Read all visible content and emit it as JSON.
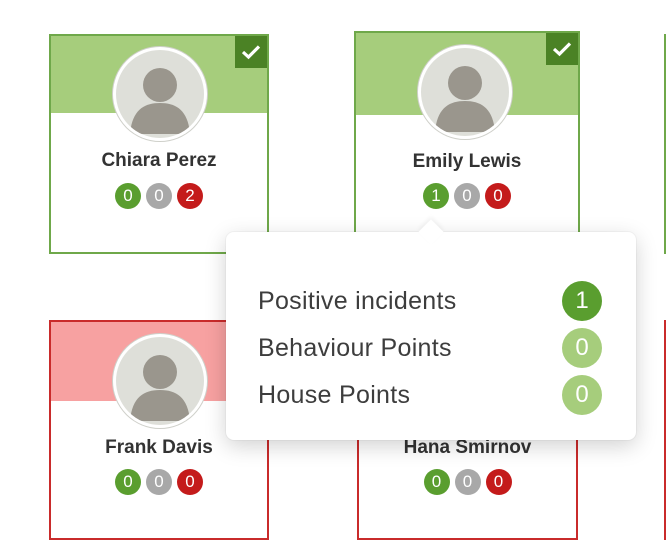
{
  "students": [
    {
      "name": "Chiara Perez",
      "status": "present",
      "selected": true,
      "counts": {
        "positive": "0",
        "neutral": "0",
        "negative": "2"
      }
    },
    {
      "name": "Emily Lewis",
      "status": "present",
      "selected": true,
      "counts": {
        "positive": "1",
        "neutral": "0",
        "negative": "0"
      }
    },
    {
      "name": "Frank Davis",
      "status": "absent",
      "selected": false,
      "counts": {
        "positive": "0",
        "neutral": "0",
        "negative": "0"
      }
    },
    {
      "name": "Hana Smirnov",
      "status": "absent",
      "selected": false,
      "counts": {
        "positive": "0",
        "neutral": "0",
        "negative": "0"
      }
    }
  ],
  "popover": {
    "rows": [
      {
        "label": "Positive incidents",
        "value": "1"
      },
      {
        "label": "Behaviour Points",
        "value": "0"
      },
      {
        "label": "House Points",
        "value": "0"
      }
    ]
  },
  "colors": {
    "present_border": "#6fa84a",
    "present_banner": "#a6cd7c",
    "absent_border": "#c92b2b",
    "absent_banner": "#f7a1a1",
    "positive": "#5a9e2f",
    "neutral": "#a8a8a8",
    "negative": "#c41b1b"
  },
  "icons": {
    "selected": "check-icon",
    "avatar": "person-silhouette-icon"
  }
}
